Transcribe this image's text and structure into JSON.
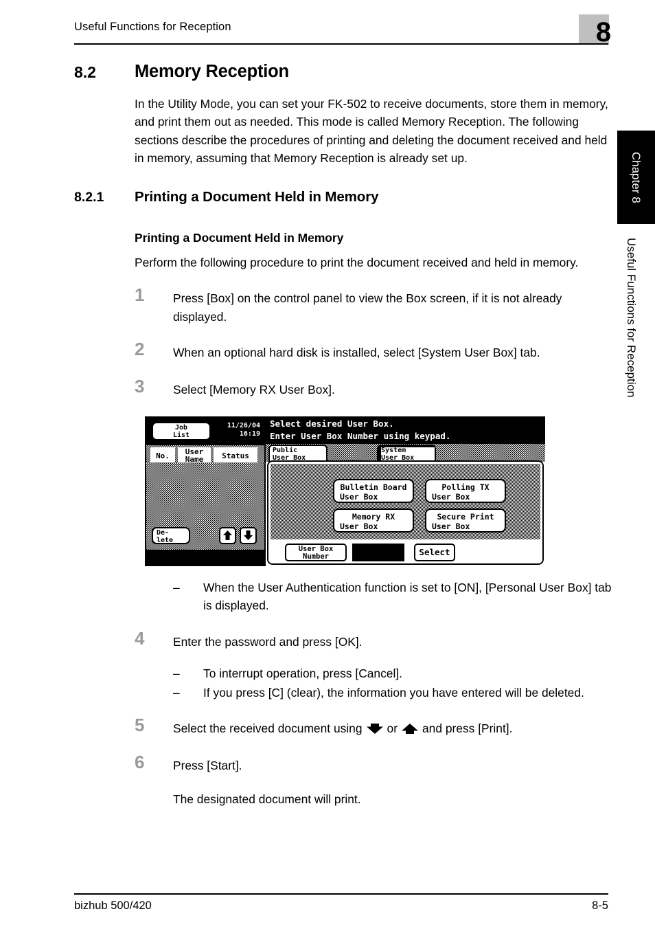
{
  "header": {
    "running_title": "Useful Functions for Reception",
    "chapter_digit": "8"
  },
  "side_tabs": {
    "chapter_label": "Chapter 8",
    "running_head": "Useful Functions for Reception"
  },
  "section": {
    "number": "8.2",
    "title": "Memory Reception",
    "intro": "In the Utility Mode, you can set your FK-502 to receive documents, store them in memory, and print them out as needed. This mode is called Memory Reception. The following sections describe the procedures of printing and deleting the document received and held in memory, assuming that Memory Reception is already set up."
  },
  "subsection": {
    "number": "8.2.1",
    "title": "Printing a Document Held in Memory",
    "heading3": "Printing a Document Held in Memory",
    "lead": "Perform the following procedure to print the document received and held in memory."
  },
  "steps": [
    {
      "num": "1",
      "text": "Press [Box] on the control panel to view the Box screen, if it is not already displayed."
    },
    {
      "num": "2",
      "text": "When an optional hard disk is installed, select [System User Box] tab."
    },
    {
      "num": "3",
      "text": "Select [Memory RX User Box]."
    },
    {
      "num": "4",
      "text": "Enter the password and press [OK]."
    },
    {
      "num": "5",
      "text_before": "Select the received document using",
      "text_middle": "or",
      "text_after": "and press [Print]."
    },
    {
      "num": "6",
      "text": "Press [Start]."
    }
  ],
  "notes": {
    "dash": "–",
    "after_step3": "When the User Authentication function is set to [ON], [Personal User Box] tab is displayed.",
    "after_step4_a": "To interrupt operation, press [Cancel].",
    "after_step4_b": "If you press [C] (clear), the information you have entered will be deleted."
  },
  "closing": "The designated document will print.",
  "lcd": {
    "job_list_line1": "Job",
    "job_list_line2": "List",
    "date": "11/26/04",
    "time": "16:19",
    "col_no": "No.",
    "col_user_name_l1": "User",
    "col_user_name_l2": "Name",
    "col_status": "Status",
    "delete_l1": "De-",
    "delete_l2": "lete",
    "arrow_up": "up-arrow-icon",
    "arrow_down": "down-arrow-icon",
    "message_l1": "Select desired User Box.",
    "message_l2": "Enter User Box Number using keypad.",
    "tab_public_l1": "Public",
    "tab_public_l2": "User Box",
    "tab_system_l1": "System",
    "tab_system_l2": "User Box",
    "btn_bulletin_l1": "Bulletin Board",
    "btn_bulletin_l2": "User Box",
    "btn_polling_l1": "Polling TX",
    "btn_polling_l2": "User Box",
    "btn_memoryrx_l1": "Memory RX",
    "btn_memoryrx_l2": "User Box",
    "btn_secure_l1": "Secure Print",
    "btn_secure_l2": "User Box",
    "btn_ubn_l1": "User Box",
    "btn_ubn_l2": "Number",
    "btn_select": "Select"
  },
  "footer": {
    "product": "bizhub 500/420",
    "page": "8-5"
  }
}
